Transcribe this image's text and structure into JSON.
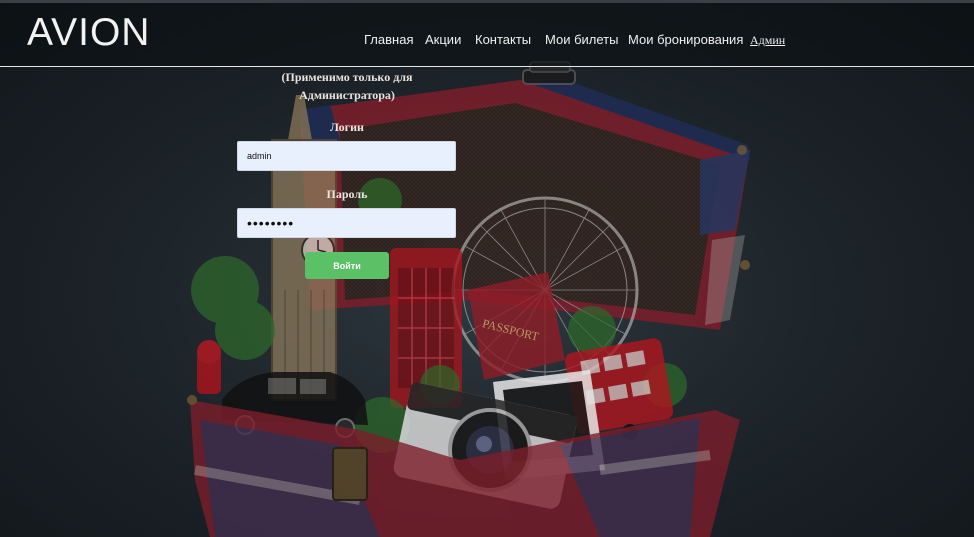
{
  "header": {
    "logo": "AVION",
    "nav": [
      {
        "label": "Главная"
      },
      {
        "label": "Акции"
      },
      {
        "label": "Контакты"
      },
      {
        "label": "Мои билеты"
      },
      {
        "label": "Мои бронирования"
      },
      {
        "label": "Админ"
      }
    ]
  },
  "form": {
    "note_line1": "(Применимо только для",
    "note_line2": "Администратора)",
    "login_label": "Логин",
    "login_value": "admin",
    "password_label": "Пароль",
    "password_value": "password",
    "submit_label": "Войти"
  },
  "background": {
    "passport_text": "PASSPORT",
    "colors": {
      "button": "#5ac167",
      "input_bg": "#e8f0fe",
      "trunk_red": "#8e2433",
      "flag_blue": "#1f2d55"
    }
  }
}
